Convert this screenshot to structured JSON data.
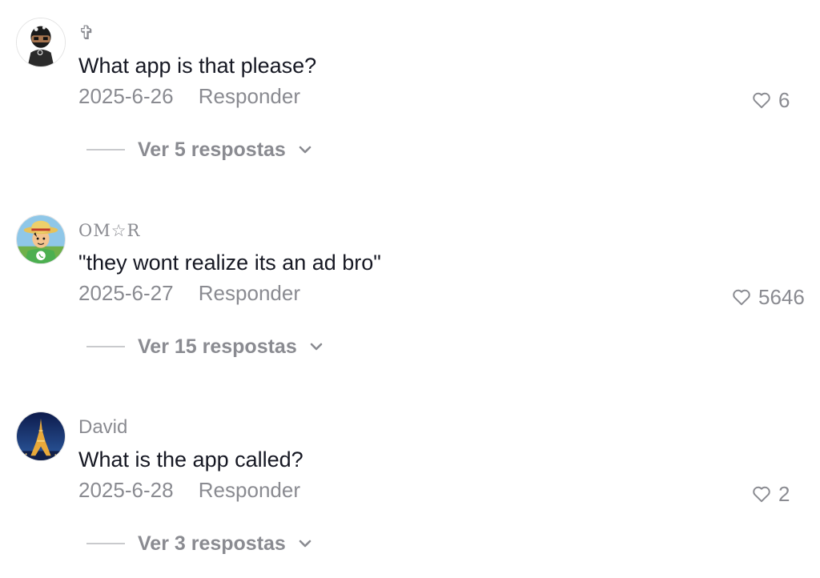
{
  "comments": [
    {
      "username": "✞",
      "text": "What app is that please?",
      "date": "2025-6-26",
      "reply_label": "Responder",
      "likes": "6",
      "view_replies": "Ver 5 respostas",
      "avatar_icon": "ninja-avatar-icon"
    },
    {
      "username": "OM☆R",
      "text": "\"they wont realize its an ad bro\"",
      "date": "2025-6-27",
      "reply_label": "Responder",
      "likes": "5646",
      "view_replies": "Ver 15 respostas",
      "avatar_icon": "straw-hat-avatar-icon"
    },
    {
      "username": "David",
      "text": "What is the app called?",
      "date": "2025-6-28",
      "reply_label": "Responder",
      "likes": "2",
      "view_replies": "Ver 3 respostas",
      "avatar_icon": "eiffel-tower-avatar-icon"
    }
  ],
  "colors": {
    "text_primary": "#161823",
    "text_secondary": "#8a8b91",
    "divider": "#c9cacd"
  }
}
